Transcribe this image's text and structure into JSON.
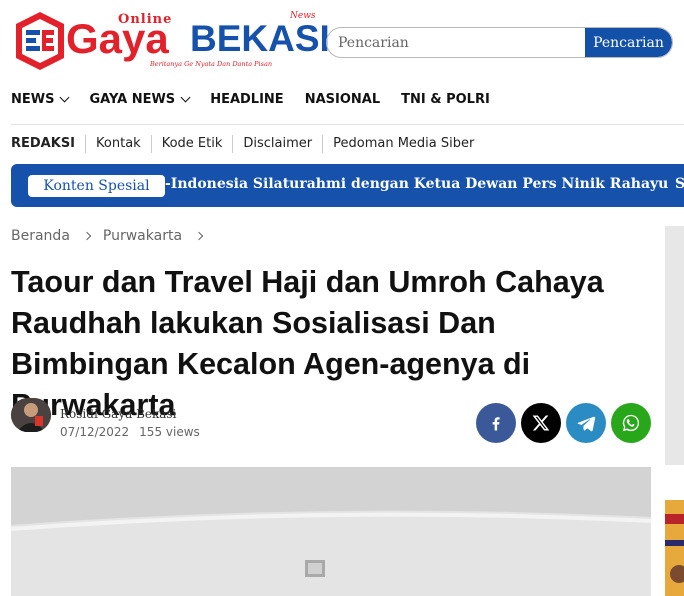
{
  "brand": {
    "logo_online": "Online",
    "logo_gaya": "Gaya",
    "logo_bekasi": "BEKASI",
    "logo_news": "News",
    "logo_tagline": "Beritanya Ge Nyata Dan Danta Pisan",
    "primary_color": "#1652ac",
    "accent_color": "#e2212b"
  },
  "search": {
    "placeholder": "Pencarian",
    "button_label": "Pencarian"
  },
  "main_nav": [
    {
      "label": "NEWS",
      "has_dropdown": true
    },
    {
      "label": "GAYA NEWS",
      "has_dropdown": true
    },
    {
      "label": "HEADLINE",
      "has_dropdown": false
    },
    {
      "label": "NASIONAL",
      "has_dropdown": false
    },
    {
      "label": "TNI & POLRI",
      "has_dropdown": false
    }
  ],
  "secondary_nav": [
    "REDAKSI",
    "Kontak",
    "Kode Etik",
    "Disclaimer",
    "Pedoman Media Siber"
  ],
  "ticker": {
    "badge": "Konten Spesial",
    "headline": "-Indonesia Silaturahmi dengan Ketua Dewan Pers Ninik Rahayu",
    "next_fragment": "S"
  },
  "breadcrumb": [
    "Beranda",
    "Purwakarta"
  ],
  "article": {
    "title": "Taour dan Travel Haji dan Umroh Cahaya Raudhah lakukan Sosialisasi Dan Bimbingan Kecalon Agen-agenya di Purwakarta",
    "author": "Rosidi Gaya Bekasi",
    "date": "07/12/2022",
    "views": "155 views"
  },
  "share_buttons": [
    {
      "name": "facebook",
      "icon": "facebook-icon",
      "color": "#3b5998"
    },
    {
      "name": "x",
      "icon": "x-icon",
      "color": "#000000"
    },
    {
      "name": "telegram",
      "icon": "telegram-icon",
      "color": "#2b8cc4"
    },
    {
      "name": "whatsapp",
      "icon": "whatsapp-icon",
      "color": "#29a71a"
    }
  ]
}
